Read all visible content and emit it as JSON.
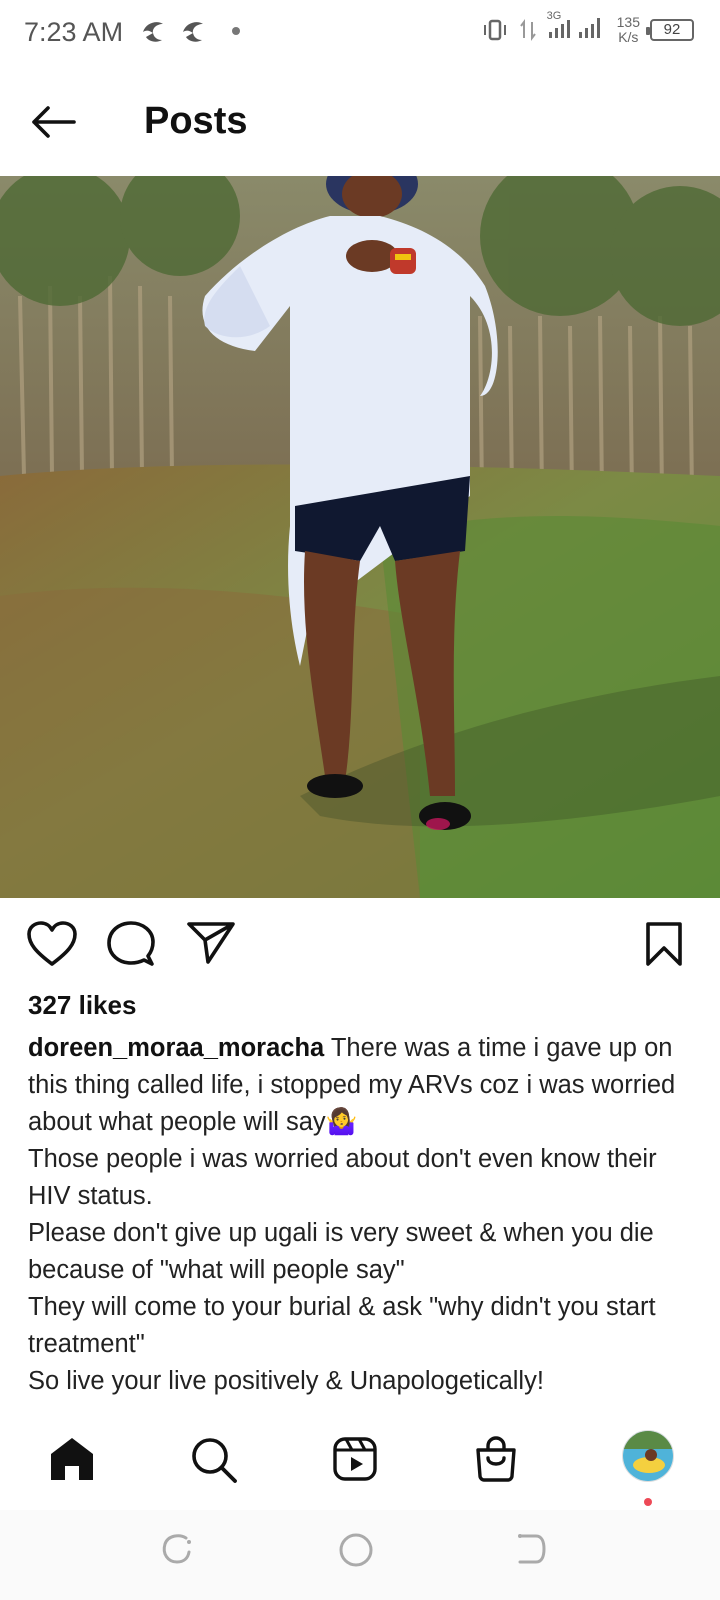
{
  "status_bar": {
    "time": "7:23 AM",
    "network_type": "3G",
    "net_speed_value": "135",
    "net_speed_unit": "K/s",
    "battery": "92",
    "icons": [
      "app-notification-icon",
      "app-notification-icon",
      "vibrate-icon",
      "data-transfer-icon",
      "signal-icon",
      "signal-icon",
      "battery-icon"
    ]
  },
  "header": {
    "title": "Posts",
    "back_icon": "arrow-left-icon"
  },
  "post": {
    "image_description_icon": "photo",
    "likes": "327 likes",
    "username": "doreen_moraa_moracha",
    "caption_lines": [
      "There was a time i gave up on this thing called life, i stopped my ARVs coz i was worried about what people will say🤷‍♀️",
      "Those people i was worried about don't even know their HIV status.",
      "Please don't give up ugali is very sweet & when you die because of \"what will people say\"",
      "They will come to your burial & ask \"why didn't you start treatment\"",
      "So live your live positively & Unapologetically!"
    ],
    "actions": [
      "heart-icon",
      "comment-icon",
      "share-icon",
      "bookmark-icon"
    ]
  },
  "bottom_nav": {
    "items": [
      "home-icon",
      "search-icon",
      "reels-icon",
      "shop-icon",
      "profile-avatar"
    ],
    "notification_color": "#ed4956"
  },
  "system_nav": {
    "items": [
      "recents-icon",
      "home-circle-icon",
      "back-icon"
    ]
  },
  "colors": {
    "text": "#262626",
    "icon": "#111111",
    "background": "#ffffff"
  }
}
